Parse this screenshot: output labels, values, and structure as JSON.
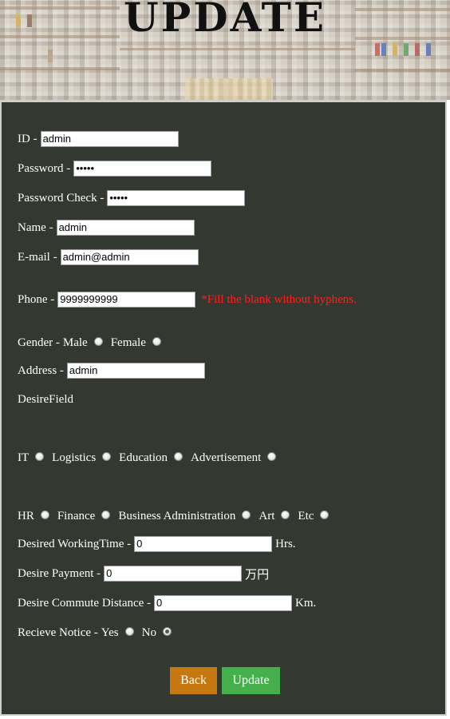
{
  "header": {
    "title": "UPDATE"
  },
  "form": {
    "id": {
      "label": "ID -",
      "value": "admin"
    },
    "password": {
      "label": "Password -",
      "value": "•••••"
    },
    "password_check": {
      "label": "Password Check -",
      "value": "•••••"
    },
    "name": {
      "label": "Name -",
      "value": "admin"
    },
    "email": {
      "label": "E-mail -",
      "value": "admin@admin"
    },
    "phone": {
      "label": "Phone -",
      "value": "9999999999",
      "hint": "*Fill the blank without hyphens."
    },
    "gender": {
      "label": "Gender -",
      "options": [
        "Male",
        "Female"
      ],
      "selected": null
    },
    "address": {
      "label": "Address -",
      "value": "admin"
    },
    "desire_field": {
      "label": "DesireField",
      "options_row1": [
        "IT",
        "Logistics",
        "Education",
        "Advertisement"
      ],
      "options_row2": [
        "HR",
        "Finance",
        "Business Administration",
        "Art",
        "Etc"
      ],
      "selected": null
    },
    "working_time": {
      "label": "Desired WorkingTime -",
      "value": "0",
      "unit": "Hrs."
    },
    "payment": {
      "label": "Desire Payment -",
      "value": "0",
      "unit": "万円"
    },
    "commute": {
      "label": "Desire Commute Distance -",
      "value": "0",
      "unit": "Km."
    },
    "notice": {
      "label": "Recieve Notice -",
      "options": [
        "Yes",
        "No"
      ],
      "selected": "No"
    }
  },
  "buttons": {
    "back_label": "Back",
    "update_label": "Update"
  },
  "colors": {
    "panel_bg": "#333830",
    "hint_red": "#ff1f1f",
    "back_button": "#c4780f",
    "update_button": "#45b04b"
  }
}
